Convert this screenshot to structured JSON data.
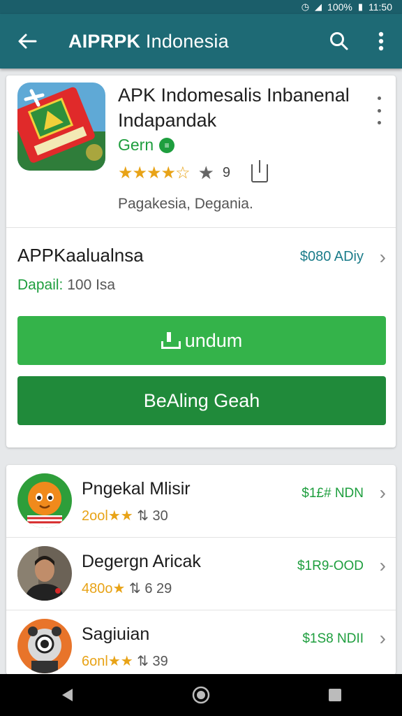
{
  "status": {
    "battery": "100%",
    "time": "11:50"
  },
  "appbar": {
    "title_bold": "AIPRPK",
    "title_rest": " Indonesia"
  },
  "app": {
    "name": "APK Indomesalis Inbanenal Indapandak",
    "developer": "Gern",
    "rating_count": "9",
    "category": "Pagakesia, Degania."
  },
  "info": {
    "title": "APPKaalualnsa",
    "price": "$080 ADiy",
    "sub_label": "Dapail:",
    "sub_value": " 100 Isa"
  },
  "buttons": {
    "primary": "undum",
    "secondary": "BeAling Geah"
  },
  "list": [
    {
      "name": "Pngekal Mlisir",
      "meta_count": "2ool",
      "meta_extra": "30",
      "price": "$1£# NDN"
    },
    {
      "name": "Degergn Aricak",
      "meta_count": "480o",
      "meta_extra": "6  29",
      "price": "$1R9-OOD"
    },
    {
      "name": "Sagiuian",
      "meta_count": "6onl",
      "meta_extra": "39",
      "price": "$1S8 NDII"
    }
  ],
  "colors": {
    "appbar": "#1e6a75",
    "accent_green": "#34b34a",
    "dark_green": "#208a3a",
    "star": "#e8a317"
  }
}
